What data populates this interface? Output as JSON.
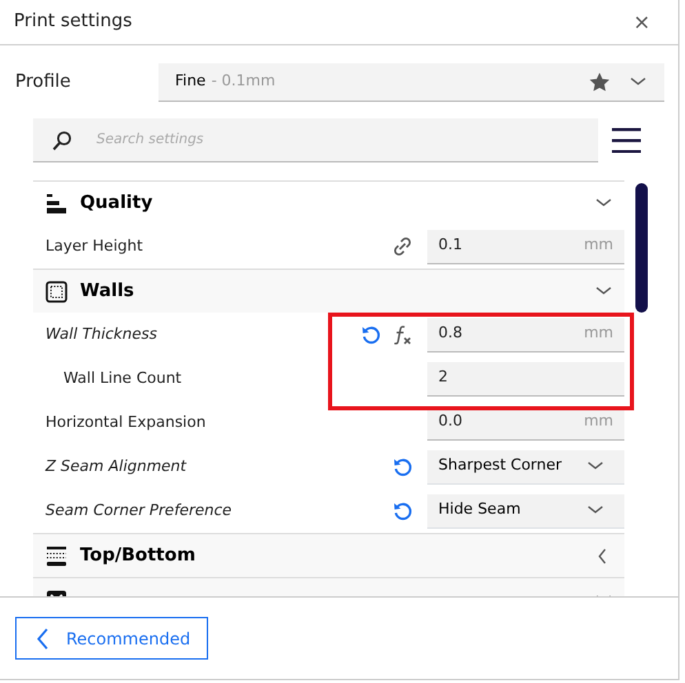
{
  "window": {
    "title": "Print settings",
    "close": "×"
  },
  "profile": {
    "label": "Profile",
    "name": "Fine",
    "detail": "- 0.1mm",
    "favorite": true
  },
  "search": {
    "placeholder": "Search settings"
  },
  "sections": [
    {
      "title": "Quality",
      "expanded": true,
      "settings": [
        {
          "label": "Layer Height",
          "modified": false,
          "linked": true,
          "kind": "number",
          "value": "0.1",
          "unit": "mm"
        }
      ]
    },
    {
      "title": "Walls",
      "expanded": true,
      "settings": [
        {
          "label": "Wall Thickness",
          "modified": true,
          "resettable": true,
          "formula": true,
          "kind": "number",
          "value": "0.8",
          "unit": "mm",
          "children": [
            {
              "label": "Wall Line Count",
              "modified": false,
              "kind": "number",
              "value": "2"
            }
          ]
        },
        {
          "label": "Horizontal Expansion",
          "modified": false,
          "kind": "number",
          "value": "0.0",
          "unit": "mm"
        },
        {
          "label": "Z Seam Alignment",
          "modified": true,
          "resettable": true,
          "kind": "select",
          "value": "Sharpest Corner"
        },
        {
          "label": "Seam Corner Preference",
          "modified": true,
          "resettable": true,
          "kind": "select",
          "value": "Hide Seam"
        }
      ]
    },
    {
      "title": "Top/Bottom",
      "expanded": false
    },
    {
      "expanded": true
    }
  ],
  "footer": {
    "button": "Recommended"
  }
}
